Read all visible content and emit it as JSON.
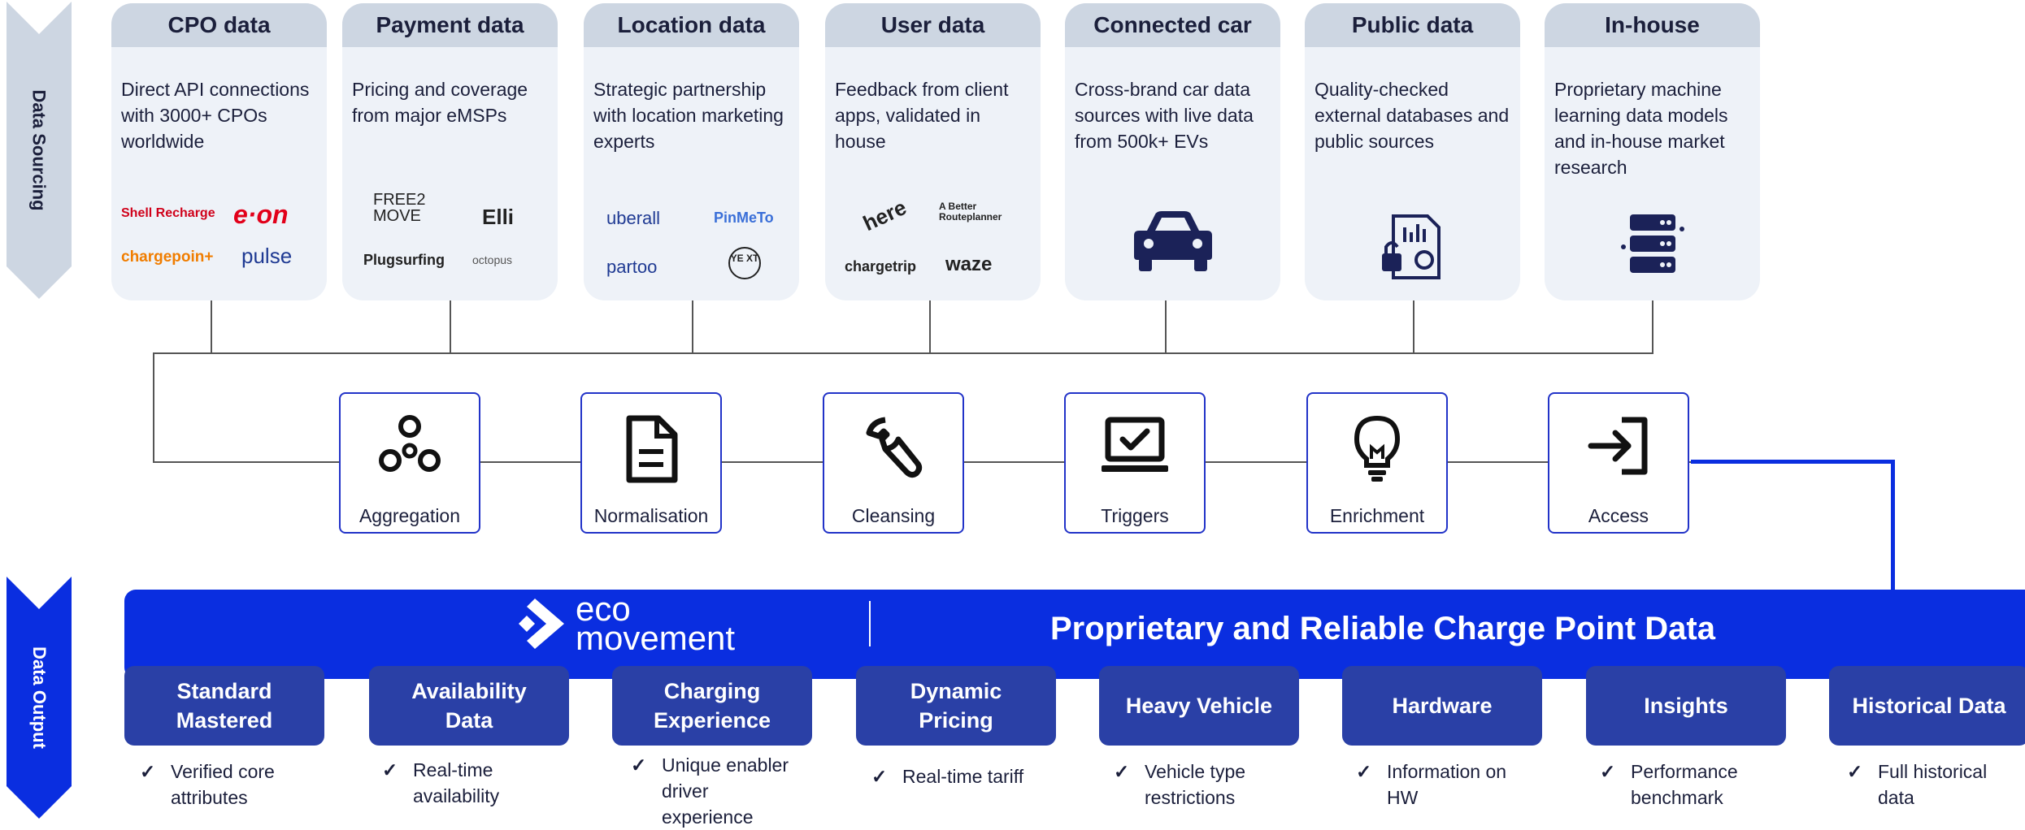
{
  "sides": {
    "sourcing_label": "Data Sourcing",
    "output_label": "Data Output"
  },
  "sources": [
    {
      "title": "CPO data",
      "desc": "Direct API connections with 3000+ CPOs worldwide",
      "logos": [
        "Shell Recharge",
        "e·on",
        "chargepoin+",
        "pulse"
      ]
    },
    {
      "title": "Payment data",
      "desc": "Pricing and coverage from major eMSPs",
      "logos": [
        "FREE2 MOVE",
        "Elli",
        "Plugsurfing",
        "octopus"
      ]
    },
    {
      "title": "Location data",
      "desc": "Strategic partnership with location marketing experts",
      "logos": [
        "uberall",
        "PinMeTo",
        "partoo",
        "YE XT"
      ]
    },
    {
      "title": "User data",
      "desc": "Feedback from client apps, validated in house",
      "logos": [
        "here",
        "A Better Routeplanner",
        "chargetrip",
        "waze"
      ]
    },
    {
      "title": "Connected car",
      "desc": "Cross-brand car data sources with live data from 500k+ EVs",
      "icon": "car-icon"
    },
    {
      "title": "Public data",
      "desc": "Quality-checked external databases and public sources",
      "icon": "public-document-lock-icon"
    },
    {
      "title": "In-house",
      "desc": "Proprietary machine learning data models and in-house market research",
      "icon": "server-stack-icon"
    }
  ],
  "steps": [
    {
      "label": "Aggregation",
      "icon": "circles-icon"
    },
    {
      "label": "Normalisation",
      "icon": "document-icon"
    },
    {
      "label": "Cleansing",
      "icon": "wrench-icon"
    },
    {
      "label": "Triggers",
      "icon": "laptop-check-icon"
    },
    {
      "label": "Enrichment",
      "icon": "lightbulb-icon"
    },
    {
      "label": "Access",
      "icon": "sign-in-icon"
    }
  ],
  "band": {
    "brand_line1": "eco",
    "brand_line2": "movement",
    "title": "Proprietary and Reliable Charge Point Data"
  },
  "outputs": [
    {
      "title": "Standard Mastered",
      "note": "Verified core attributes"
    },
    {
      "title": "Availability Data",
      "note": "Real-time availability"
    },
    {
      "title": "Charging Experience",
      "note": "Unique enabler driver experience"
    },
    {
      "title": "Dynamic Pricing",
      "note": "Real-time tariff"
    },
    {
      "title": "Heavy Vehicle",
      "note": "Vehicle type restrictions"
    },
    {
      "title": "Hardware",
      "note": "Information on HW"
    },
    {
      "title": "Insights",
      "note": "Performance benchmark"
    },
    {
      "title": "Historical Data",
      "note": "Full historical data"
    }
  ],
  "check_glyph": "✓",
  "colors": {
    "band_blue": "#0a2ee0",
    "box_navy": "#2a40a6",
    "card_bg": "#eef2f8",
    "card_head": "#cdd6e2",
    "step_border": "#2233c8"
  }
}
